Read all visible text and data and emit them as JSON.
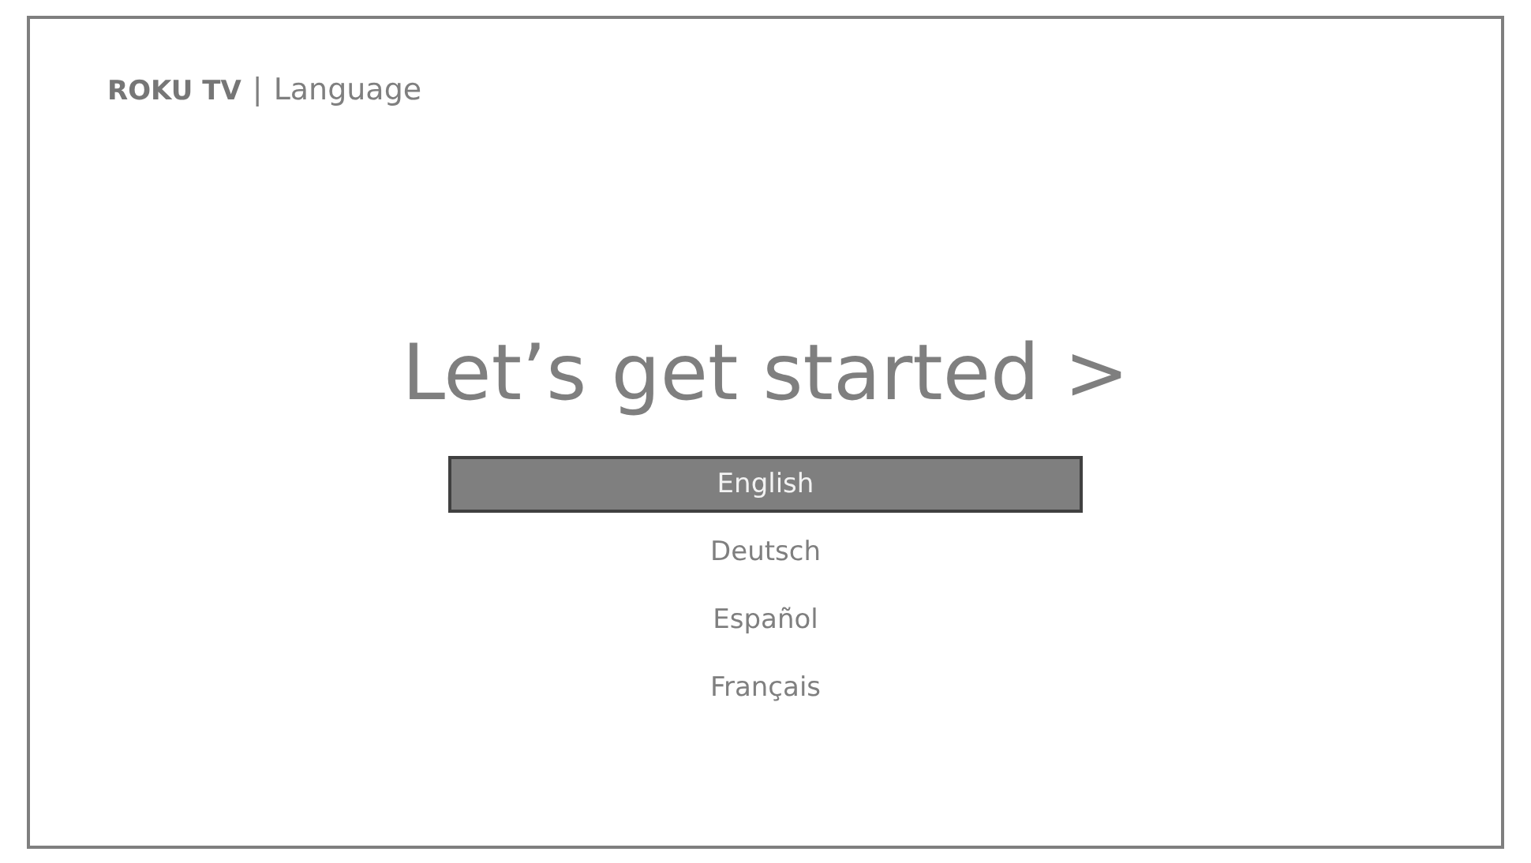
{
  "header": {
    "logo": "ROKU TV",
    "separator": "|",
    "title": "Language"
  },
  "heading": "Let’s get started >",
  "languages": [
    {
      "label": "English",
      "selected": true
    },
    {
      "label": "Deutsch",
      "selected": false
    },
    {
      "label": "Español",
      "selected": false
    },
    {
      "label": "Français",
      "selected": false
    }
  ]
}
